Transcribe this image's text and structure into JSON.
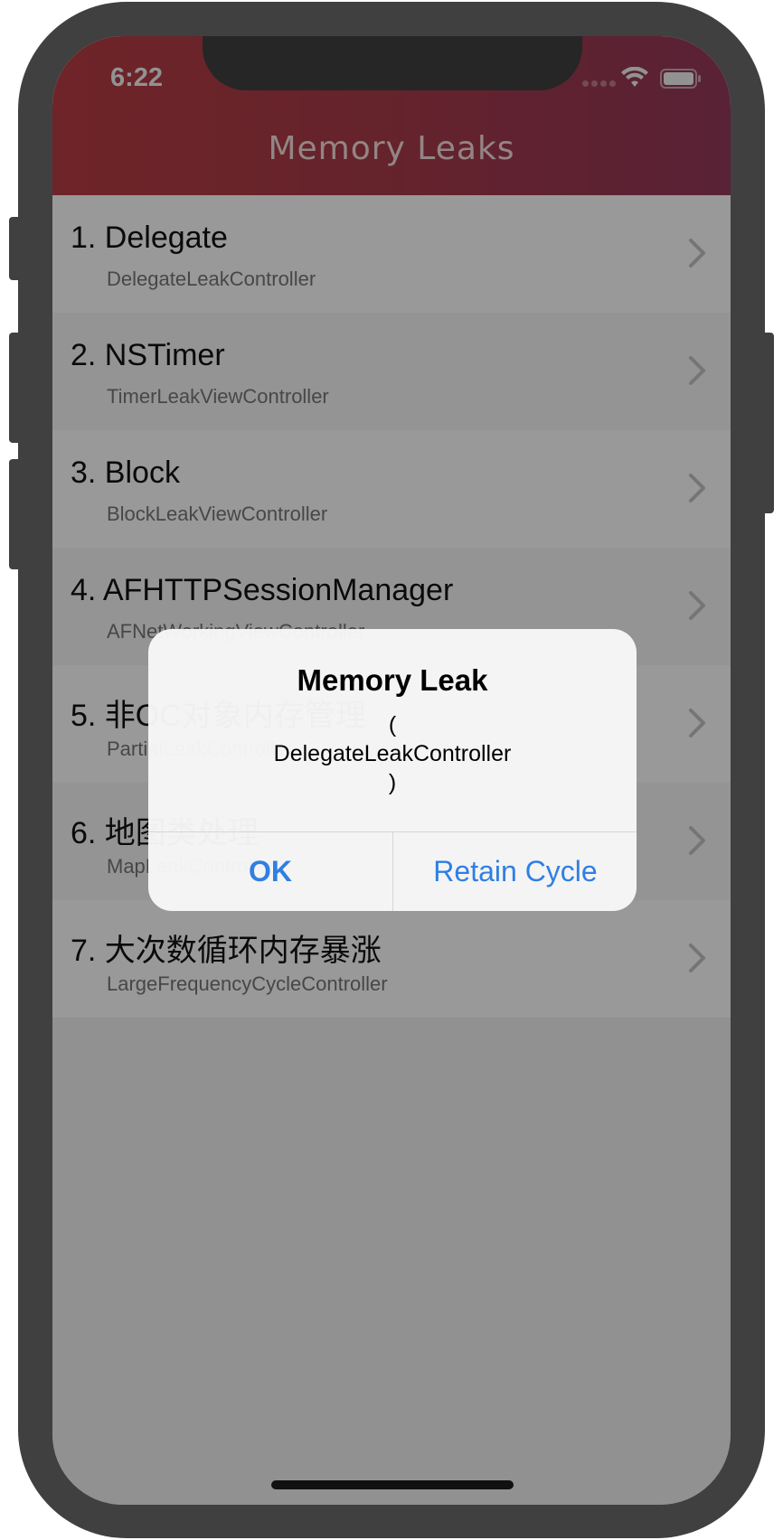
{
  "status_bar": {
    "time": "6:22"
  },
  "navigation": {
    "title": "Memory Leaks"
  },
  "list": {
    "items": [
      {
        "title": "1. Delegate",
        "subtitle": "DelegateLeakController"
      },
      {
        "title": "2. NSTimer",
        "subtitle": "TimerLeakViewController"
      },
      {
        "title": "3. Block",
        "subtitle": "BlockLeakViewController"
      },
      {
        "title": "4. AFHTTPSessionManager",
        "subtitle": "AFNetWorkingViewController"
      },
      {
        "title": "5. 非OC对象内存管理",
        "subtitle": "PartialLeakController"
      },
      {
        "title": "6. 地图类处理",
        "subtitle": "MapLeakController"
      },
      {
        "title": "7. 大次数循环内存暴涨",
        "subtitle": "LargeFrequencyCycleController"
      }
    ]
  },
  "alert": {
    "title": "Memory Leak",
    "message_line1": "(",
    "message_line2": "DelegateLeakController",
    "message_line3": ")",
    "ok_label": "OK",
    "retain_label": "Retain Cycle"
  },
  "colors": {
    "header_start": "#b83c44",
    "header_end": "#94395a",
    "button_blue": "#2f7fe4"
  }
}
